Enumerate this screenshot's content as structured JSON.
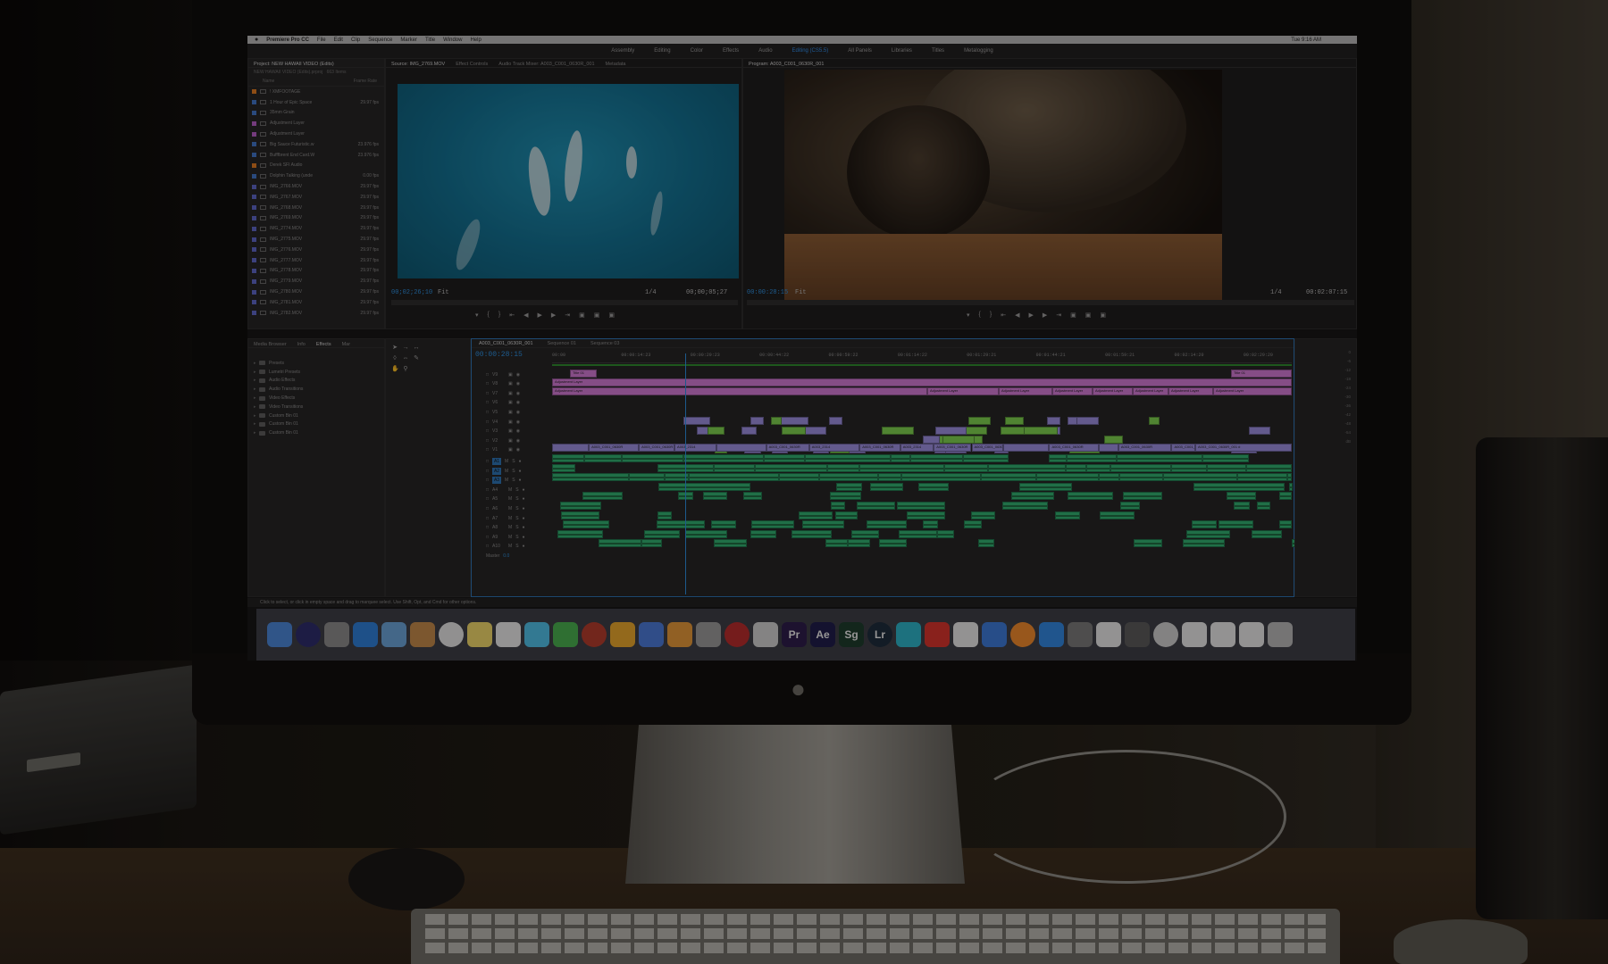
{
  "menubar": {
    "app": "Premiere Pro CC",
    "items": [
      "File",
      "Edit",
      "Clip",
      "Sequence",
      "Marker",
      "Title",
      "Window",
      "Help"
    ],
    "clock": "Tue 9:16 AM"
  },
  "workspaces": {
    "items": [
      "Assembly",
      "Editing",
      "Color",
      "Effects",
      "Audio",
      "Editing (CS5.5)",
      "All Panels",
      "Libraries",
      "Titles",
      "Metalogging"
    ],
    "active": "Editing (CS5.5)"
  },
  "project": {
    "tab": "Project: NEW HAWAII VIDEO (Edits)",
    "subtitle": "NEW HAWAII VIDEO (Edits).prproj",
    "item_count": "663 Items",
    "col_name": "Name",
    "col_rate": "Frame Rate",
    "rows": [
      {
        "name": "! XMFOOTAGE",
        "rate": "",
        "color": "#e07a1f",
        "folder": true
      },
      {
        "name": "1 Hour of Epic Space",
        "rate": "29.97 fps",
        "color": "#3f74c8",
        "folder": false
      },
      {
        "name": "35mm Grain",
        "rate": "",
        "color": "#3f74c8",
        "folder": true
      },
      {
        "name": "Adjustment Layer",
        "rate": "",
        "color": "#b65cc7",
        "folder": false
      },
      {
        "name": "Adjustment Layer",
        "rate": "",
        "color": "#b65cc7",
        "folder": false
      },
      {
        "name": "Big Sauce Futuristic.w",
        "rate": "23.976 fps",
        "color": "#3f74c8",
        "folder": false
      },
      {
        "name": "Bufffbrent End Card.W",
        "rate": "23.976 fps",
        "color": "#3f74c8",
        "folder": false
      },
      {
        "name": "Derek SFI Audio",
        "rate": "",
        "color": "#e07a1f",
        "folder": true
      },
      {
        "name": "Dolphin Talking (unde",
        "rate": "0.00 fps",
        "color": "#3f74c8",
        "folder": false
      },
      {
        "name": "IMG_2766.MOV",
        "rate": "29.97 fps",
        "color": "#5c66c8",
        "folder": false
      },
      {
        "name": "IMG_2767.MOV",
        "rate": "29.97 fps",
        "color": "#5c66c8",
        "folder": false
      },
      {
        "name": "IMG_2768.MOV",
        "rate": "29.97 fps",
        "color": "#5c66c8",
        "folder": false
      },
      {
        "name": "IMG_2769.MOV",
        "rate": "29.97 fps",
        "color": "#5c66c8",
        "folder": false
      },
      {
        "name": "IMG_2774.MOV",
        "rate": "29.97 fps",
        "color": "#5c66c8",
        "folder": false
      },
      {
        "name": "IMG_2775.MOV",
        "rate": "29.97 fps",
        "color": "#5c66c8",
        "folder": false
      },
      {
        "name": "IMG_2776.MOV",
        "rate": "29.97 fps",
        "color": "#5c66c8",
        "folder": false
      },
      {
        "name": "IMG_2777.MOV",
        "rate": "29.97 fps",
        "color": "#5c66c8",
        "folder": false
      },
      {
        "name": "IMG_2778.MOV",
        "rate": "29.97 fps",
        "color": "#5c66c8",
        "folder": false
      },
      {
        "name": "IMG_2779.MOV",
        "rate": "29.97 fps",
        "color": "#5c66c8",
        "folder": false
      },
      {
        "name": "IMG_2780.MOV",
        "rate": "29.97 fps",
        "color": "#5c66c8",
        "folder": false
      },
      {
        "name": "IMG_2781.MOV",
        "rate": "29.97 fps",
        "color": "#5c66c8",
        "folder": false
      },
      {
        "name": "IMG_2782.MOV",
        "rate": "29.97 fps",
        "color": "#5c66c8",
        "folder": false
      }
    ]
  },
  "source": {
    "tabs": [
      "Source: IMG_2769.MOV",
      "Effect Controls",
      "Audio Track Mixer: A003_C001_0630R_001",
      "Metadata"
    ],
    "timecode": "00;02;26;10",
    "fit": "Fit",
    "scale": "1/4",
    "duration": "00;00;05;27"
  },
  "program": {
    "tab": "Program: A003_C001_0630R_001",
    "timecode": "00:00:28:15",
    "fit": "Fit",
    "scale": "1/4",
    "duration": "00:02:07:15"
  },
  "effects": {
    "tabs": [
      "Media Browser",
      "Info",
      "Effects",
      "Mar"
    ],
    "active": "Effects",
    "items": [
      "Presets",
      "Lumetri Presets",
      "Audio Effects",
      "Audio Transitions",
      "Video Effects",
      "Video Transitions",
      "Custom Bin 01",
      "Custom Bin 01",
      "Custom Bin 01"
    ]
  },
  "timeline": {
    "tabs": [
      "A003_C001_0630R_001",
      "Sequence 01",
      "Sequence 03"
    ],
    "active": "A003_C001_0630R_001",
    "timecode": "00:00:28:15",
    "ruler": [
      "00:00",
      "00:00:14:23",
      "00:00:29:23",
      "00:00:44:22",
      "00:00:59:22",
      "00:01:14:22",
      "00:01:29:21",
      "00:01:44:21",
      "00:01:59:21",
      "00:02:14:20",
      "00:02:29:20"
    ],
    "video_tracks": [
      "V9",
      "V8",
      "V7",
      "V6",
      "V5",
      "V4",
      "V3",
      "V2",
      "V1"
    ],
    "audio_tracks": [
      "A1",
      "A2",
      "A3",
      "A4",
      "A5",
      "A6",
      "A7",
      "A8",
      "A9",
      "A10"
    ],
    "master": "Master",
    "master_value": "0.0",
    "adjustment_label": "Adjustment Layer",
    "clip_labels": {
      "title": "Title 01",
      "vclip": "A003_C001_0630R",
      "long": "A003_C001_0630R_001 #",
      "short": "A003_2314"
    },
    "playhead_fraction": 0.18,
    "colors": {
      "adjustment": "#d27ad6",
      "video": "#9b8fe0",
      "audio": "#2fb070",
      "accent": "#2b8fe0"
    }
  },
  "meters": {
    "scale": [
      "0",
      "-6",
      "-12",
      "-18",
      "-24",
      "-30",
      "-36",
      "-42",
      "-48",
      "-54",
      "dB"
    ]
  },
  "statusbar": {
    "text": "Click to select, or click in empty space and drag to marquee select. Use Shift, Opt, and Cmd for other options."
  },
  "dock": {
    "icons": [
      {
        "name": "finder-icon",
        "label": "",
        "color": "#4a86d8"
      },
      {
        "name": "siri-icon",
        "label": "",
        "color": "#2b2b6b"
      },
      {
        "name": "launchpad-icon",
        "label": "",
        "color": "#8b8b8b"
      },
      {
        "name": "safari-icon",
        "label": "",
        "color": "#2d7fd8"
      },
      {
        "name": "preview-icon",
        "label": "",
        "color": "#6aa3d8"
      },
      {
        "name": "contacts-icon",
        "label": "",
        "color": "#c48a4a"
      },
      {
        "name": "calendar-icon",
        "label": "",
        "color": "#e6e6e6"
      },
      {
        "name": "notes-icon",
        "label": "",
        "color": "#f0d86a"
      },
      {
        "name": "reminders-icon",
        "label": "",
        "color": "#eaeaea"
      },
      {
        "name": "messages-icon",
        "label": "",
        "color": "#4ec1e8"
      },
      {
        "name": "facetime-icon",
        "label": "",
        "color": "#48b04e"
      },
      {
        "name": "photo-booth-icon",
        "label": "",
        "color": "#b33a2a"
      },
      {
        "name": "photos-icon",
        "label": "",
        "color": "#e8a62a"
      },
      {
        "name": "keynote-icon",
        "label": "",
        "color": "#4a7ad8"
      },
      {
        "name": "pages-icon",
        "label": "",
        "color": "#e69838"
      },
      {
        "name": "image-capture-icon",
        "label": "",
        "color": "#9a9a9a"
      },
      {
        "name": "record-icon",
        "label": "",
        "color": "#b82a2a"
      },
      {
        "name": "script-icon",
        "label": "",
        "color": "#d0d0d0"
      },
      {
        "name": "premiere-pro-icon",
        "label": "Pr",
        "color": "#2a1a4a"
      },
      {
        "name": "after-effects-icon",
        "label": "Ae",
        "color": "#1c1a4a"
      },
      {
        "name": "speedgrade-icon",
        "label": "Sg",
        "color": "#1a3a2a"
      },
      {
        "name": "lightroom-icon",
        "label": "Lr",
        "color": "#1a2a3a"
      },
      {
        "name": "network-icon",
        "label": "",
        "color": "#2ab3c8"
      },
      {
        "name": "creative-cloud-icon",
        "label": "",
        "color": "#d8322a"
      },
      {
        "name": "itunes-icon",
        "label": "",
        "color": "#e8e8e8"
      },
      {
        "name": "keychain-icon",
        "label": "",
        "color": "#3a7ad8"
      },
      {
        "name": "ibooks-icon",
        "label": "",
        "color": "#f08a2a"
      },
      {
        "name": "app-store-icon",
        "label": "",
        "color": "#2f86e0"
      },
      {
        "name": "system-preferences-icon",
        "label": "",
        "color": "#7a7a7a"
      },
      {
        "name": "textedit-icon",
        "label": "",
        "color": "#e8e8e8"
      },
      {
        "name": "screenshot-icon",
        "label": "",
        "color": "#5a5a5a"
      },
      {
        "name": "finder-window-icon",
        "label": "",
        "color": "#cfcfcf"
      },
      {
        "name": "document-icon",
        "label": "",
        "color": "#e8e8e8"
      },
      {
        "name": "document-2-icon",
        "label": "",
        "color": "#e8e8e8"
      },
      {
        "name": "document-3-icon",
        "label": "",
        "color": "#e8e8e8"
      },
      {
        "name": "trash-icon",
        "label": "",
        "color": "#b8b8b8"
      }
    ]
  }
}
